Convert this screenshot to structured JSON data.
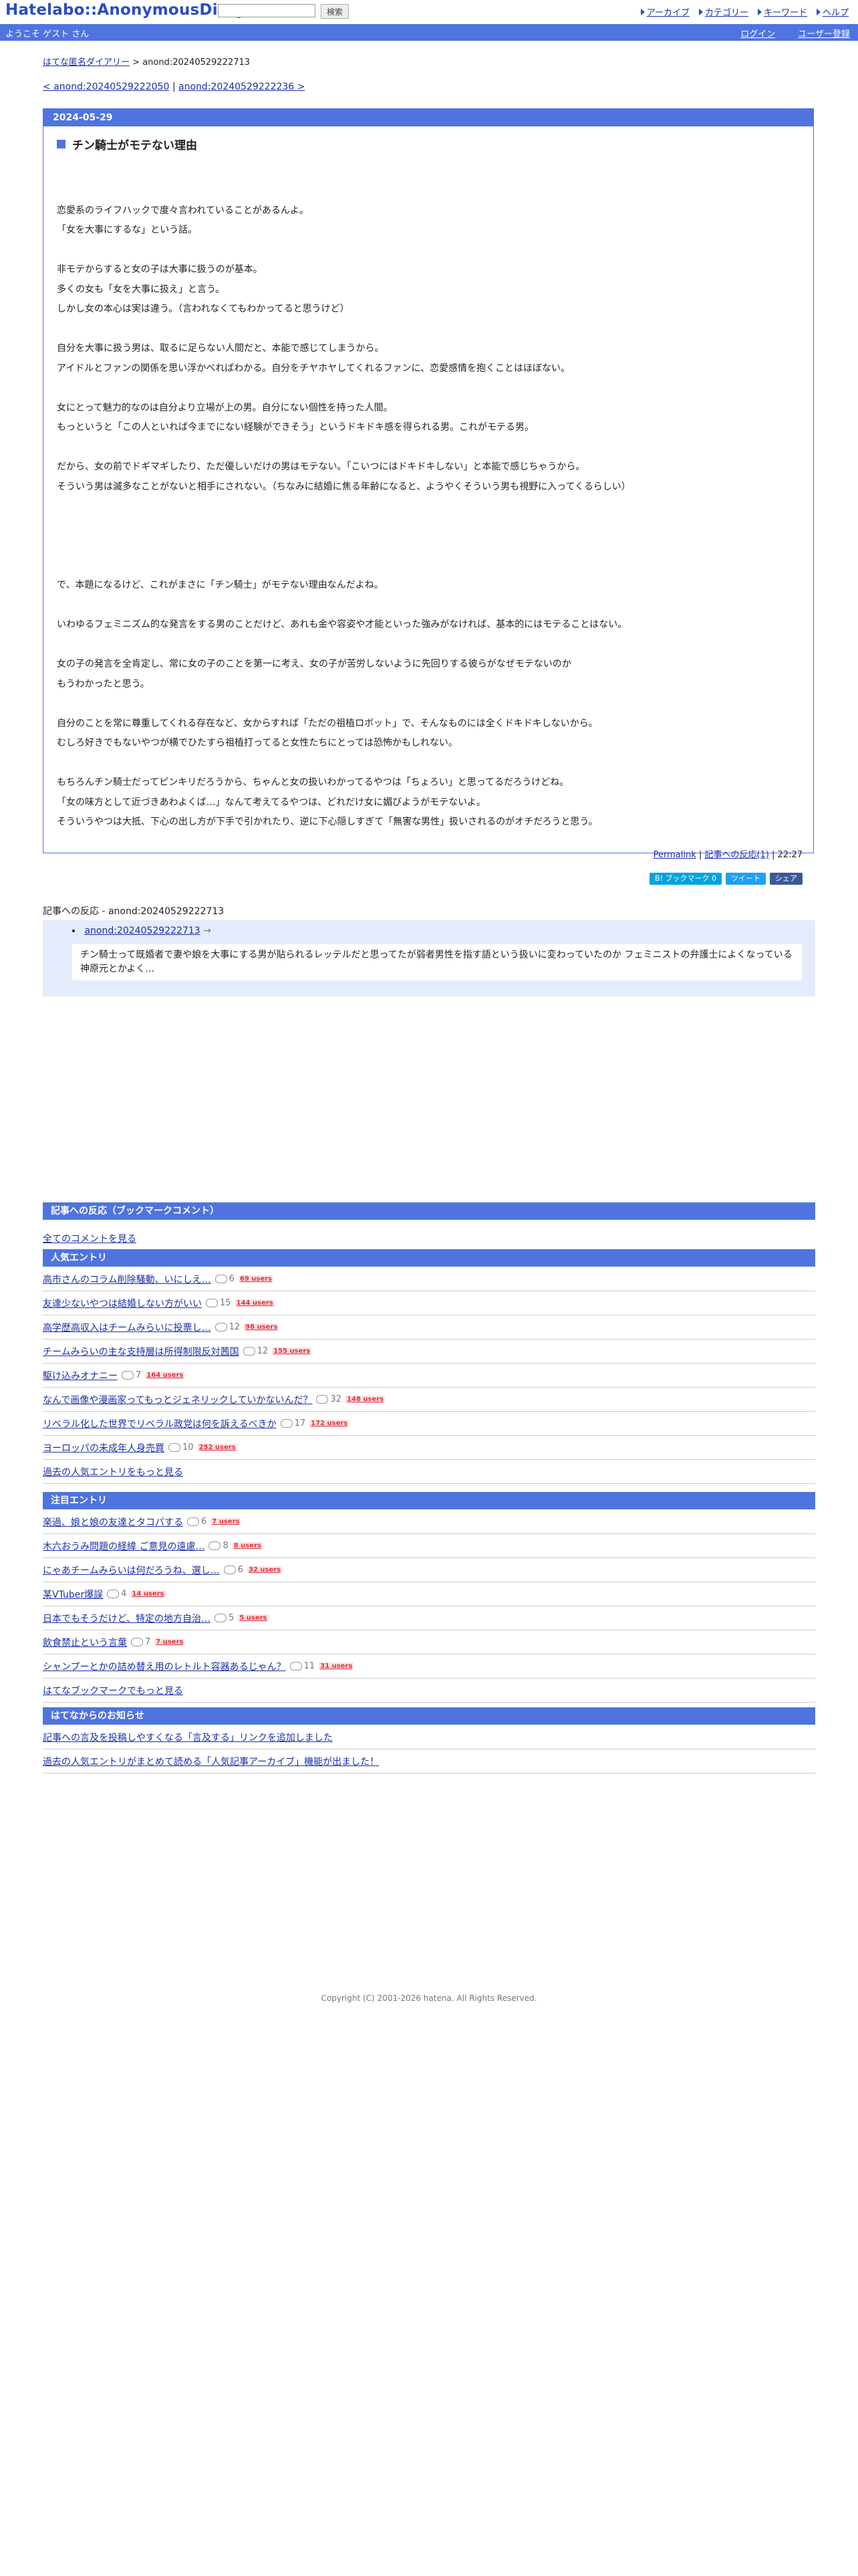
{
  "header": {
    "logo": "Hatelabo::AnonymousDiary",
    "search_placeholder": "",
    "search_button": "検索",
    "nav": [
      "アーカイブ",
      "カテゴリー",
      "キーワード",
      "ヘルプ"
    ]
  },
  "userbar": {
    "welcome": "ようこそ ゲスト さん",
    "login": "ログイン",
    "register": "ユーザー登録"
  },
  "breadcrumb": {
    "home": "はてな匿名ダイアリー",
    "sep": ">",
    "current": "anond:20240529222713"
  },
  "pager": {
    "prev": "< anond:20240529222050",
    "sep": "|",
    "next": "anond:20240529222236 >"
  },
  "article": {
    "date": "2024-05-29",
    "title": "チン騎士がモテない理由",
    "lines": [
      "",
      "恋愛系のライフハックで度々言われていることがあるんよ。",
      "「女を大事にするな」という話。",
      "",
      "非モテからすると女の子は大事に扱うのが基本。",
      "多くの女も「女を大事に扱え」と言う。",
      "しかし女の本心は実は違う。（言われなくてもわかってると思うけど）",
      "",
      "自分を大事に扱う男は、取るに足らない人間だと、本能で感じてしまうから。",
      "アイドルとファンの関係を思い浮かべればわかる。自分をチヤホヤしてくれるファンに、恋愛感情を抱くことはほぼない。",
      "",
      "女にとって魅力的なのは自分より立場が上の男。自分にない個性を持った人間。",
      "もっというと「この人といれば今までにない経験ができそう」というドキドキ感を得られる男。これがモテる男。",
      "",
      "だから、女の前でドギマギしたり、ただ優しいだけの男はモテない。「こいつにはドキドキしない」と本能で感じちゃうから。",
      "そういう男は滅多なことがないと相手にされない。（ちなみに結婚に焦る年齢になると、ようやくそういう男も視野に入ってくるらしい）",
      "",
      "",
      "",
      "",
      "で、本題になるけど、これがまさに「チン騎士」がモテない理由なんだよね。",
      "",
      "いわゆるフェミニズム的な発言をする男のことだけど、あれも金や容姿や才能といった強みがなければ、基本的にはモテることはない。",
      "",
      "女の子の発言を全肯定し、常に女の子のことを第一に考え、女の子が苦労しないように先回りする彼らがなぜモテないのか",
      "もうわかったと思う。",
      "",
      "自分のことを常に尊重してくれる存在など、女からすれば「ただの祖植ロボット」で、そんなものには全くドキドキしないから。",
      "むしろ好きでもないやつが横でひたすら祖植打ってると女性たちにとっては恐怖かもしれない。",
      "",
      "もちろんチン騎士だってピンキリだろうから、ちゃんと女の扱いわかってるやつは「ちょろい」と思ってるだろうけどね。",
      "「女の味方として近づきあわよくば…」なんて考えてるやつは、どれだけ女に媚びようがモテないよ。",
      "そういうやつは大抵、下心の出し方が下手で引かれたり、逆に下心隠しすぎて「無害な男性」扱いされるのがオチだろうと思う。"
    ],
    "permalink": "Permalink",
    "reaction_link": "記事への反応(1)",
    "time": "22:27",
    "share": [
      "B! ブックマーク 0",
      "ツイート",
      "シェア"
    ]
  },
  "reactions": {
    "title": "記事への反応 - anond:20240529222713",
    "entry": "anond:20240529222713",
    "entry_suffix": "→",
    "excerpt": "チン騎士って既婚者で妻や娘を大事にする男が貼られるレッテルだと思ってたが弱者男性を指す語という扱いに変わっていたのか フェミニストの弁護士によくなっている神原元とかよく…"
  },
  "bookmark_comments": {
    "header": "記事への反応（ブックマークコメント）",
    "all_link": "全てのコメントを見る"
  },
  "popular": {
    "header": "人気エントリ",
    "items": [
      {
        "title": "高市さんのコラム削除騒動、いにしえ…",
        "comments": "6",
        "users": "69 users"
      },
      {
        "title": "友達少ないやつは結婚しない方がいい",
        "comments": "15",
        "users": "144 users"
      },
      {
        "title": "高学歴高収入はチームみらいに投票し…",
        "comments": "12",
        "users": "98 users"
      },
      {
        "title": "チームみらいの主な支持層は所得制限反対茜国",
        "comments": "12",
        "users": "155 users"
      },
      {
        "title": "駆け込みオナニー",
        "comments": "7",
        "users": "164 users"
      },
      {
        "title": "なんで画像や漫画家ってもっとジェネリックしていかないんだ？",
        "comments": "32",
        "users": "148 users"
      },
      {
        "title": "リベラル化した世界でリベラル政党は何を訴えるべきか",
        "comments": "17",
        "users": "172 users"
      },
      {
        "title": "ヨーロッパの未成年人身売買",
        "comments": "10",
        "users": "252 users"
      }
    ],
    "more": "過去の人気エントリをもっと見る"
  },
  "notable": {
    "header": "注目エントリ",
    "items": [
      {
        "title": "楽過、娘と娘の友達とタコパする",
        "comments": "6",
        "users": "7 users"
      },
      {
        "title": "木六おうみ問題の経緯 ご意見の遠慮…",
        "comments": "8",
        "users": "8 users"
      },
      {
        "title": "にゃあチームみらいは何だろうね、選し…",
        "comments": "6",
        "users": "32 users"
      },
      {
        "title": "某VTuber爆誤",
        "comments": "4",
        "users": "14 users"
      },
      {
        "title": "日本でもそうだけど、特定の地方自治…",
        "comments": "5",
        "users": "5 users"
      },
      {
        "title": "飲食禁止という言葉",
        "comments": "7",
        "users": "7 users"
      },
      {
        "title": "シャンプーとかの詰め替え用のレトルト容器あるじゃん？",
        "comments": "11",
        "users": "31 users"
      }
    ],
    "more": "はてなブックマークでもっと見る"
  },
  "notices": {
    "header": "はてなからのお知らせ",
    "items": [
      "記事への言及を投稿しやすくなる「言及する」リンクを追加しました",
      "過去の人気エントリがまとめて読める「人気記事アーカイブ」機能が出ました！"
    ]
  },
  "footer": {
    "copyright": "Copyright (C) 2001-2026 hatena. All Rights Reserved."
  },
  "colors": {
    "accent": "#4f74e0",
    "link": "#1a2fa8",
    "users_red": "#e0323c"
  }
}
